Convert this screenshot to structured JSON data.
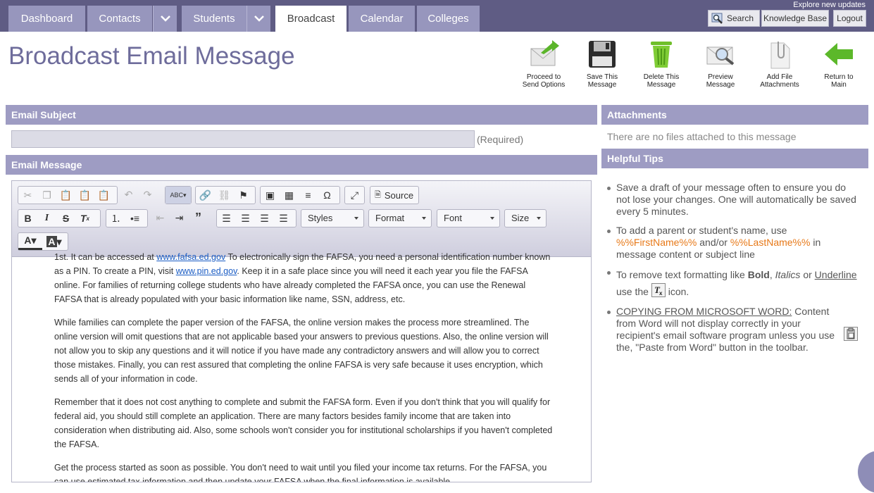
{
  "nav": {
    "tabs": [
      {
        "label": "Dashboard"
      },
      {
        "label": "Contacts"
      },
      {
        "label": "Students"
      },
      {
        "label": "Broadcast"
      },
      {
        "label": "Calendar"
      },
      {
        "label": "Colleges"
      }
    ],
    "explore": "Explore new updates",
    "search": "Search",
    "knowledge_base": "Knowledge Base",
    "logout": "Logout"
  },
  "page": {
    "title": "Broadcast Email Message"
  },
  "actions": [
    {
      "line1": "Proceed to",
      "line2": "Send Options",
      "icon": "send-icon"
    },
    {
      "line1": "Save This",
      "line2": "Message",
      "icon": "floppy-icon"
    },
    {
      "line1": "Delete This",
      "line2": "Message",
      "icon": "trash-icon"
    },
    {
      "line1": "Preview",
      "line2": "Message",
      "icon": "preview-icon"
    },
    {
      "line1": "Add File",
      "line2": "Attachments",
      "icon": "paperclip-icon"
    },
    {
      "line1": "Return to",
      "line2": "Main",
      "icon": "arrow-left-icon"
    }
  ],
  "subject": {
    "header": "Email Subject",
    "value": "",
    "required": "(Required)"
  },
  "message": {
    "header": "Email Message"
  },
  "attachments": {
    "header": "Attachments",
    "empty": "There are no files attached to this message"
  },
  "tips": {
    "header": "Helpful Tips",
    "t1": "Save a draft of your message often to ensure you do not lose your changes. One will automatically be saved every 5 minutes.",
    "t2a": "To add a parent or student's name, use ",
    "t2_first": "%%FirstName%%",
    "t2b": " and/or ",
    "t2_last": "%%LastName%%",
    "t2c": " in message content or subject line",
    "t3a": "To remove text formatting like ",
    "t3_bold": "Bold",
    "t3_sep1": ", ",
    "t3_italics": "Italics",
    "t3_or": " or ",
    "t3_underline": "Underline",
    "t3b": "use the ",
    "t3c": " icon.",
    "t4_head": "COPYING FROM MICROSOFT WORD:",
    "t4": " Content from Word will not display correctly in your recipient's email software program unless you use the, \"Paste from Word\" button in the toolbar."
  },
  "editor": {
    "source": "Source",
    "styles": "Styles",
    "format": "Format",
    "font": "Font",
    "size": "Size",
    "p1a": "1st. It can be accessed at ",
    "link1": "www.fafsa.ed.gov",
    "p1b": " To electronically sign the FAFSA, you need a personal identification number known as a PIN. To create a PIN, visit ",
    "link2": "www.pin.ed.gov",
    "p1c": ".  Keep it in a safe place since you will need it each year you file the FAFSA online.  For families of returning college students who have already completed the FAFSA once, you can use the Renewal FAFSA that is already populated with your basic information like name, SSN, address, etc.",
    "p2": "While families can complete the paper version of the FAFSA, the online version makes the process more streamlined. The online version will omit questions that are not applicable based your answers to previous questions. Also, the online version will not allow you to skip any questions and it will notice if you have made any contradictory answers and will allow you to correct those mistakes. Finally, you can rest assured that completing the online FAFSA is very safe because it uses encryption, which sends all of your information in code.",
    "p3": "Remember that it does not cost anything to complete and submit the FAFSA form. Even if you don't think that you will qualify for federal aid, you should still complete an application. There are many factors besides family income that are taken into consideration when distributing aid. Also, some schools won't consider you for institutional scholarships if you haven't completed the FAFSA.",
    "p4": "Get the process started as soon as possible. You don't need to wait until you filed your income tax returns. For the FAFSA, you can use estimated tax information and then update your FAFSA when the final information is available."
  }
}
